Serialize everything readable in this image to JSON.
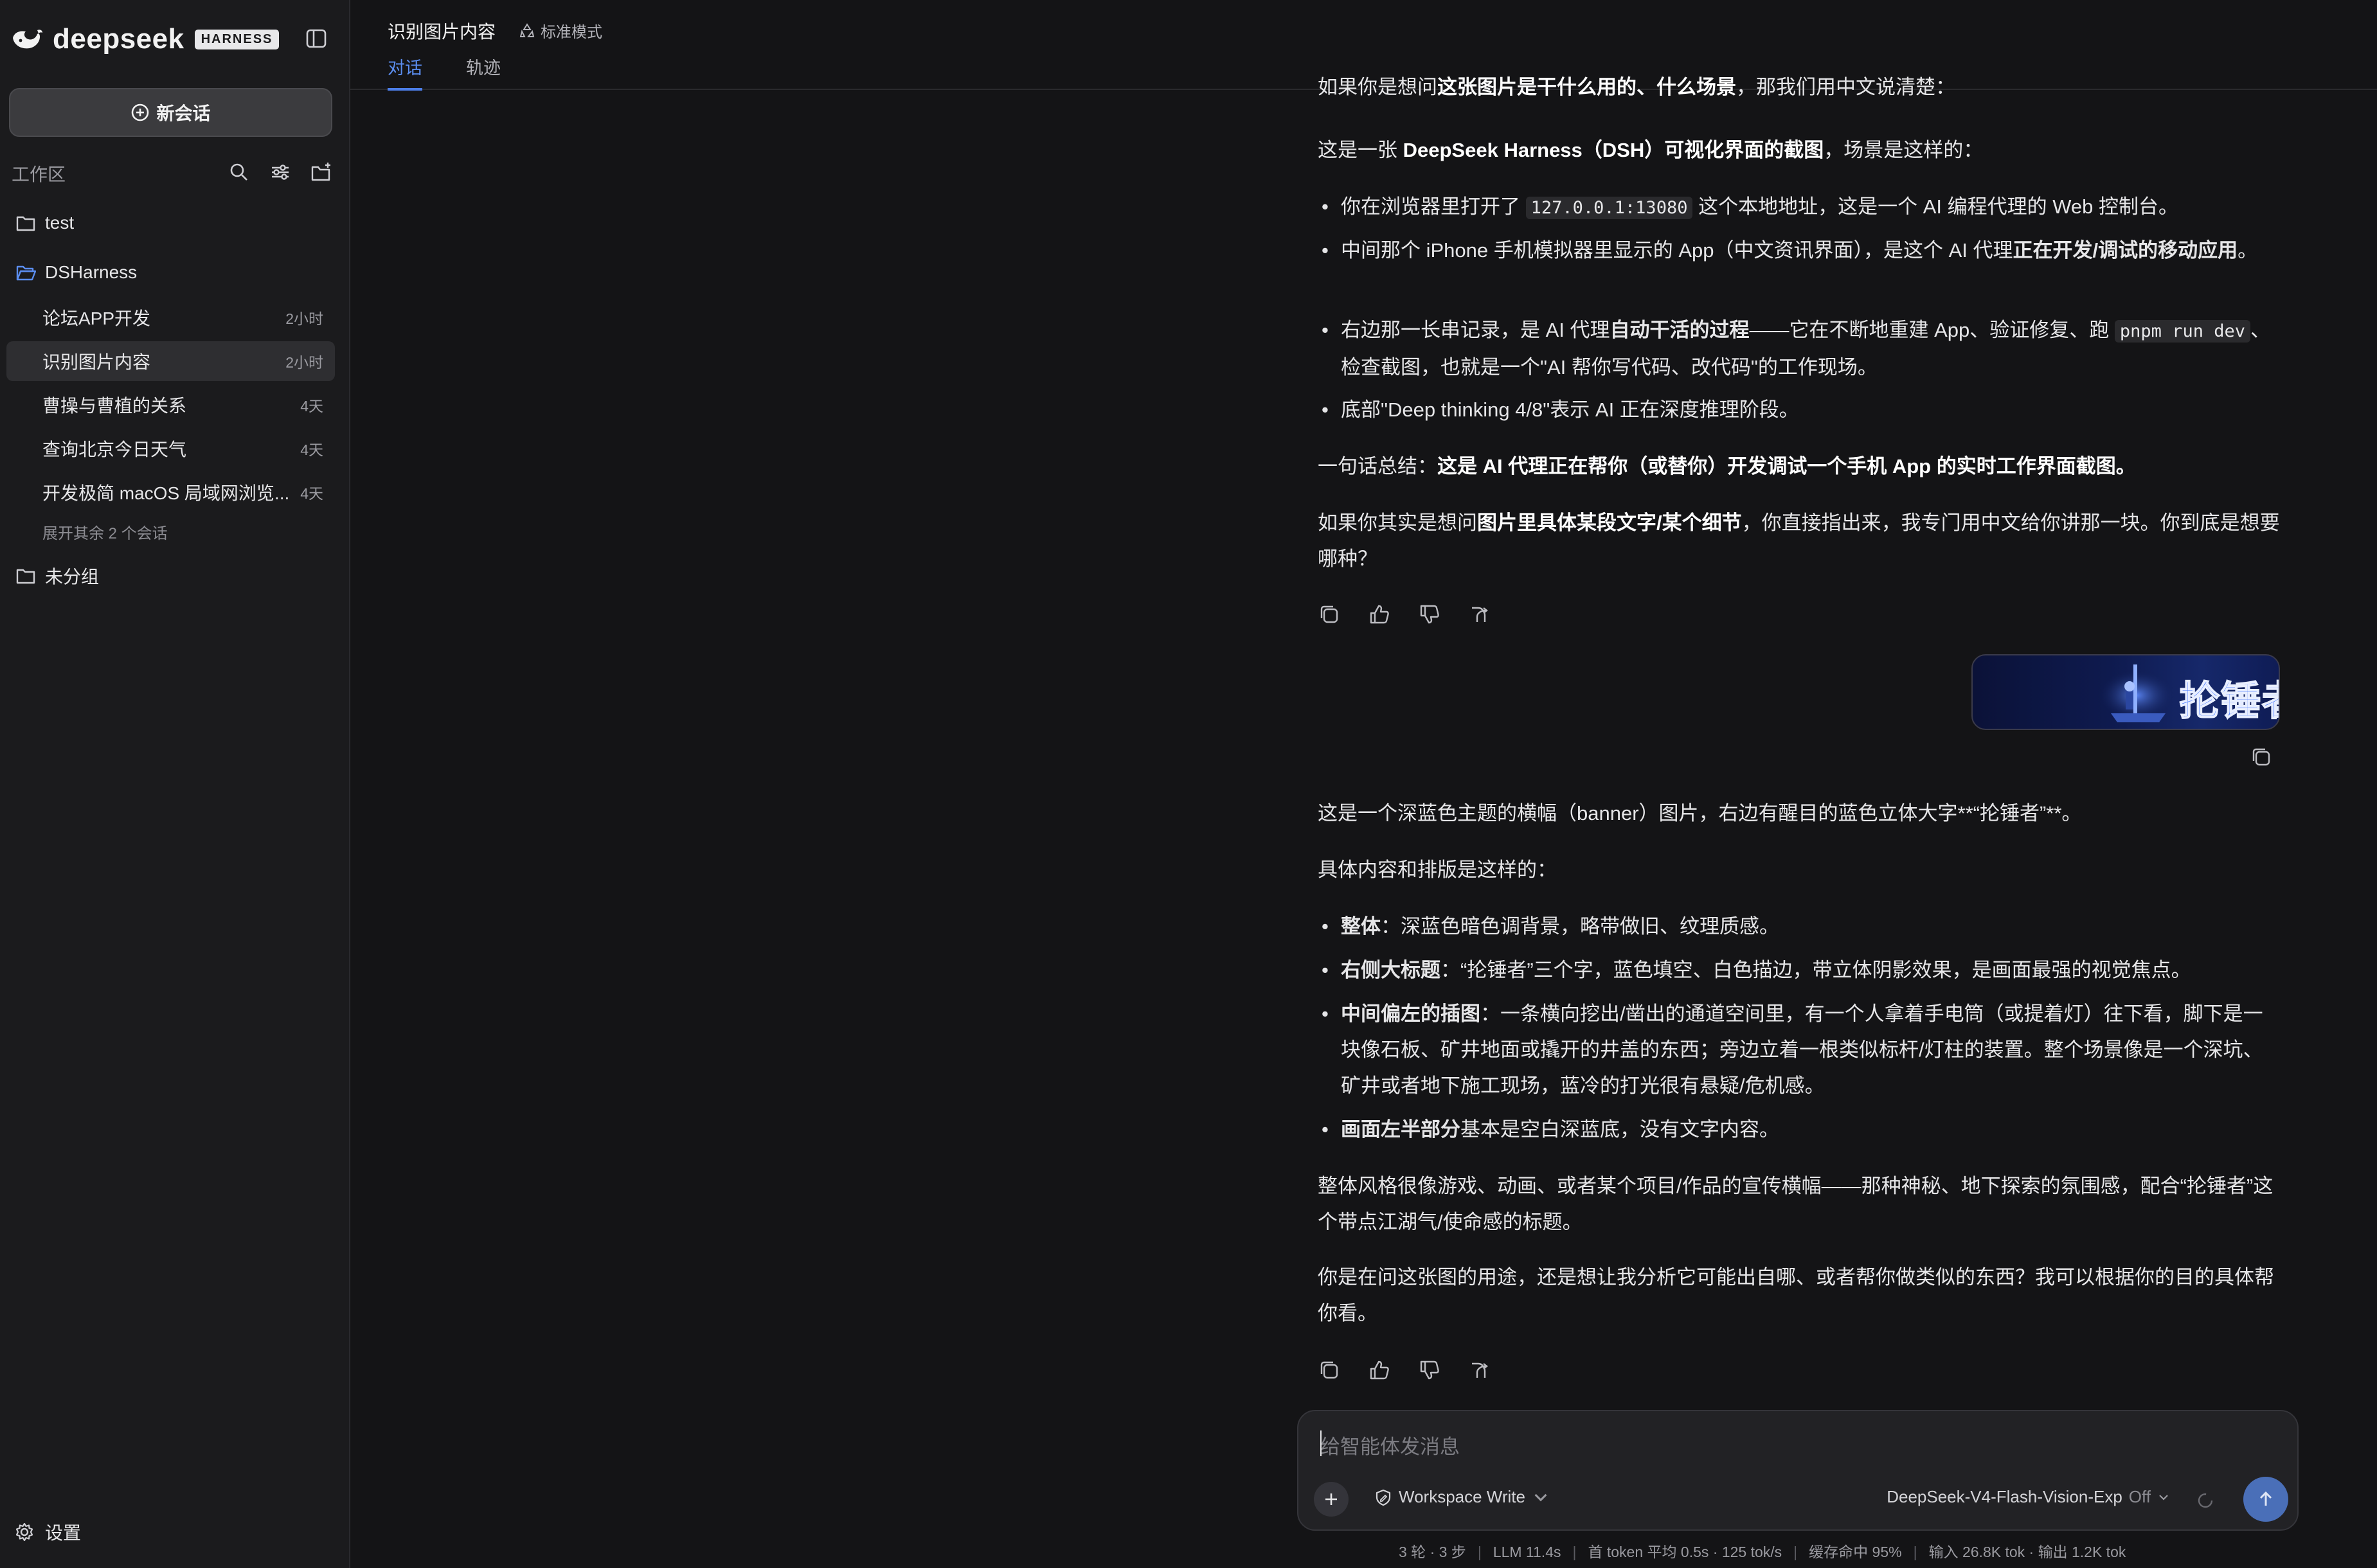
{
  "sidebar": {
    "brand_name": "deepseek",
    "brand_badge": "HARNESS",
    "new_chat_label": "新会话",
    "workspace_label": "工作区",
    "folders": [
      {
        "name": "test"
      },
      {
        "name": "DSHarness"
      },
      {
        "name": "未分组"
      }
    ],
    "conversations": [
      {
        "title": "论坛APP开发",
        "time": "2小时"
      },
      {
        "title": "识别图片内容",
        "time": "2小时"
      },
      {
        "title": "曹操与曹植的关系",
        "time": "4天"
      },
      {
        "title": "查询北京今日天气",
        "time": "4天"
      },
      {
        "title": "开发极简 macOS 局域网浏览...",
        "time": "4天"
      }
    ],
    "expand_label": "展开其余 2 个会话",
    "settings_label": "设置"
  },
  "header": {
    "title": "识别图片内容",
    "mode": "标准模式",
    "tabs": [
      "对话",
      "轨迹"
    ]
  },
  "chat": {
    "m1_intro_a": "如果你是想问",
    "m1_intro_b": "这张图片是干什么用的、什么场景",
    "m1_intro_c": "，那我们用中文说清楚：",
    "m1_p1_a": "这是一张 ",
    "m1_p1_b": "DeepSeek Harness（DSH）可视化界面的截图",
    "m1_p1_c": "，场景是这样的：",
    "m1_b1_a": "你在浏览器里打开了 ",
    "m1_b1_code": "127.0.0.1:13080",
    "m1_b1_b": " 这个本地地址，这是一个 AI 编程代理的 Web 控制台。",
    "m1_b2_a": "中间那个 iPhone 手机模拟器里显示的 App（中文资讯界面），是这个 AI 代理",
    "m1_b2_b": "正在开发/调试的移动应用",
    "m1_b2_c": "。",
    "m1_b3_a": "右边那一长串记录，是 AI 代理",
    "m1_b3_b": "自动干活的过程",
    "m1_b3_c": "——它在不断地重建 App、验证修复、跑 ",
    "m1_b3_code": "pnpm run dev",
    "m1_b3_d": "、检查截图，也就是一个\"AI 帮你写代码、改代码\"的工作现场。",
    "m1_b4": "底部\"Deep thinking 4/8\"表示 AI 正在深度推理阶段。",
    "m1_sum_a": "一句话总结：",
    "m1_sum_b": "这是 AI 代理正在帮你（或替你）开发调试一个手机 App 的实时工作界面截图。",
    "m1_end_a": "如果你其实是想问",
    "m1_end_b": "图片里具体某段文字/某个细节",
    "m1_end_c": "，你直接指出来，我专门用中文给你讲那一块。你到底是想要哪种？",
    "banner_text": "抡锤者",
    "m2_p1": "这是一个深蓝色主题的横幅（banner）图片，右边有醒目的蓝色立体大字**“抡锤者”**。",
    "m2_p2": "具体内容和排版是这样的：",
    "m2_b1_a": "整体",
    "m2_b1_b": "：深蓝色暗色调背景，略带做旧、纹理质感。",
    "m2_b2_a": "右侧大标题",
    "m2_b2_b": "：“抡锤者”三个字，蓝色填空、白色描边，带立体阴影效果，是画面最强的视觉焦点。",
    "m2_b3_a": "中间偏左的插图",
    "m2_b3_b": "：一条横向挖出/凿出的通道空间里，有一个人拿着手电筒（或提着灯）往下看，脚下是一块像石板、矿井地面或撬开的井盖的东西；旁边立着一根类似标杆/灯柱的装置。整个场景像是一个深坑、矿井或者地下施工现场，蓝冷的打光很有悬疑/危机感。",
    "m2_b4_a": "画面左半部分",
    "m2_b4_b": "基本是空白深蓝底，没有文字内容。",
    "m2_p3": "整体风格很像游戏、动画、或者某个项目/作品的宣传横幅——那种神秘、地下探索的氛围感，配合“抡锤者”这个带点江湖气/使命感的标题。",
    "m2_p4": "你是在问这张图的用途，还是想让我分析它可能出自哪、或者帮你做类似的东西？我可以根据你的目的具体帮你看。"
  },
  "composer": {
    "placeholder": "给智能体发消息",
    "permission": "Workspace Write",
    "model": "DeepSeek-V4-Flash-Vision-Exp",
    "thinking": "Off"
  },
  "stats": {
    "turns": "3 轮 · 3 步",
    "llm": "LLM 11.4s",
    "first_token": "首 token 平均 0.5s · 125 tok/s",
    "cache": "缓存命中 95%",
    "io": "输入 26.8K tok · 输出 1.2K tok"
  },
  "colors": {
    "accent": "#4c7ee8",
    "background": "#141416",
    "sidebar": "#1b1b1d",
    "banner": "#0e1a4e"
  }
}
